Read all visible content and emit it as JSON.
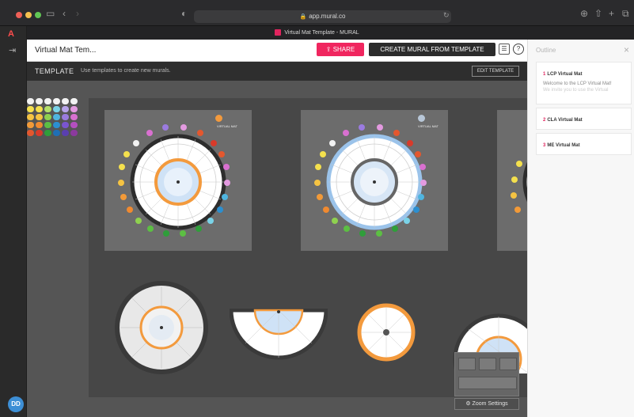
{
  "browser": {
    "url": "app.mural.co",
    "tab_title": "Virtual Mat Template - MURAL"
  },
  "app": {
    "logo_letter": "A",
    "avatar_initials": "DD"
  },
  "header": {
    "mural_title": "Virtual Mat Tem...",
    "share_label": "SHARE",
    "create_label": "CREATE MURAL FROM TEMPLATE",
    "help_label": "?"
  },
  "template_bar": {
    "label": "TEMPLATE",
    "description": "Use templates to create new murals.",
    "edit_label": "EDIT TEMPLATE"
  },
  "canvas": {
    "mat_label_1": "VIRTUAL MAT",
    "mat_label_2": "VIRTUAL MAT",
    "zoom_label": "Zoom Settings"
  },
  "outline": {
    "title": "Outline",
    "items": [
      {
        "num": "1",
        "name": "LCP Virtual Mat",
        "body": "Welcome to the LCP Virtual Mat!",
        "body2": "We invite you to use the Virtual"
      },
      {
        "num": "2",
        "name": "CLA Virtual Mat"
      },
      {
        "num": "3",
        "name": "ME Virtual Mat"
      }
    ]
  },
  "colors": {
    "share": "#f0265f",
    "accent_orange": "#f39a3d",
    "accent_blue": "#9bc3ea",
    "canvas": "#555555"
  }
}
